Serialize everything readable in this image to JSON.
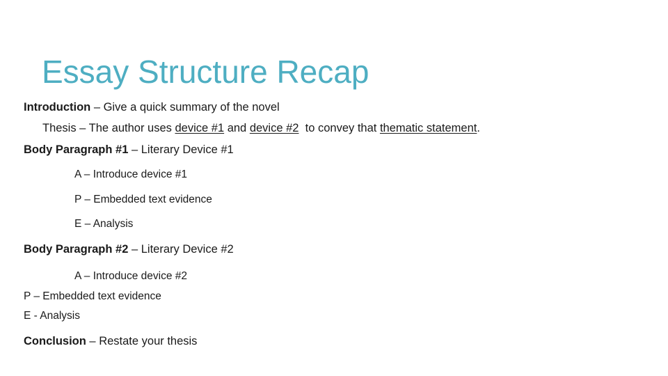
{
  "slide": {
    "title": "Essay Structure Recap",
    "intro": {
      "bold": "Introduction",
      "text": " – Give a quick summary of the novel"
    },
    "thesis": {
      "prefix": "Thesis – The author uses ",
      "device1": "device #1",
      "and": " and ",
      "device2": "device #2",
      "middle": "  to convey that ",
      "statement": "thematic statement",
      "end": "."
    },
    "body1": {
      "bold": "Body Paragraph #1",
      "text": " – Literary Device #1",
      "items": [
        "A – Introduce device #1",
        "P – Embedded text evidence",
        "E – Analysis"
      ]
    },
    "body2": {
      "bold": "Body Paragraph #2",
      "text": " – Literary Device #2",
      "items": [
        "A – Introduce device #2",
        "P – Embedded text evidence",
        "E - Analysis"
      ]
    },
    "conclusion": {
      "bold": "Conclusion",
      "text": " – Restate your thesis"
    }
  }
}
